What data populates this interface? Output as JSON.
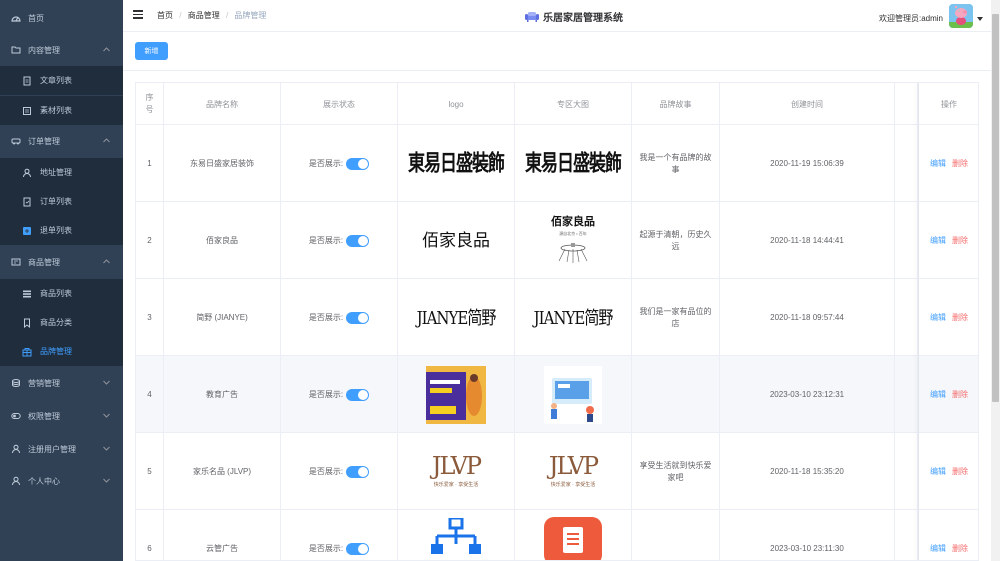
{
  "sidebar": {
    "items": [
      {
        "label": "首页",
        "icon": "dashboard-icon",
        "type": "top",
        "active": false
      },
      {
        "label": "内容管理",
        "icon": "folder-icon",
        "type": "group",
        "active": false
      },
      {
        "label": "文章列表",
        "icon": "document-icon",
        "type": "sub",
        "active": false
      },
      {
        "label": "素材列表",
        "icon": "media-icon",
        "type": "sub",
        "active": false
      },
      {
        "label": "订单管理",
        "icon": "truck-icon",
        "type": "group",
        "active": false
      },
      {
        "label": "地址管理",
        "icon": "user-icon",
        "type": "sub",
        "active": false
      },
      {
        "label": "订单列表",
        "icon": "order-icon",
        "type": "sub",
        "active": false
      },
      {
        "label": "退单列表",
        "icon": "refund-icon",
        "type": "sub",
        "active": false
      },
      {
        "label": "商品管理",
        "icon": "goods-icon",
        "type": "group",
        "active": false
      },
      {
        "label": "商品列表",
        "icon": "list-icon",
        "type": "sub",
        "active": false
      },
      {
        "label": "商品分类",
        "icon": "bookmark-icon",
        "type": "sub",
        "active": false
      },
      {
        "label": "品牌管理",
        "icon": "brand-icon",
        "type": "sub",
        "active": true
      },
      {
        "label": "营销管理",
        "icon": "coins-icon",
        "type": "group",
        "active": false
      },
      {
        "label": "权限管理",
        "icon": "toggle-icon",
        "type": "group",
        "active": false
      },
      {
        "label": "注册用户管理",
        "icon": "user-icon",
        "type": "group",
        "active": false
      },
      {
        "label": "个人中心",
        "icon": "user-icon",
        "type": "group",
        "active": false
      }
    ]
  },
  "header": {
    "breadcrumb": [
      "首页",
      "商品管理",
      "品牌管理"
    ],
    "separator": "/",
    "system_title": "乐居家居管理系统",
    "welcome": "欢迎管理员:admin"
  },
  "toolbar": {
    "add_label": "新增"
  },
  "table": {
    "columns": [
      "序号",
      "品牌名称",
      "展示状态",
      "logo",
      "专区大图",
      "品牌故事",
      "创建时间",
      "",
      "操作"
    ],
    "switch_label": "是否展示:",
    "edit_label": "编辑",
    "delete_label": "删除",
    "rows": [
      {
        "index": "1",
        "name": "东易日盛家居装饰",
        "story": "我是一个有品牌的故事",
        "created": "2020-11-19 15:06:39",
        "logo_text": "東易日盛裝飾",
        "banner_text": "東易日盛裝飾",
        "image_kind": "dongyi",
        "shown": true
      },
      {
        "index": "2",
        "name": "佰家良品",
        "story": "起源于清朝，历史久远",
        "created": "2020-11-18 14:44:41",
        "logo_text": "佰家良品",
        "banner_text": "佰家良品",
        "banner_sub": "源自北京 • 百年",
        "image_kind": "baijia",
        "shown": true
      },
      {
        "index": "3",
        "name": "简野 (JIANYE)",
        "story": "我们是一家有品位的店",
        "created": "2020-11-18 09:57:44",
        "logo_text": "JIANYE简野",
        "banner_text": "JIANYE简野",
        "image_kind": "jianye",
        "shown": true
      },
      {
        "index": "4",
        "name": "教育广告",
        "story": "",
        "created": "2023-03-10 23:12:31",
        "logo_text": "暑期快乐",
        "banner_text": "",
        "image_kind": "edu",
        "shown": true
      },
      {
        "index": "5",
        "name": "家乐名品 (JLVP)",
        "story": "享受生活就到快乐爱家吧",
        "created": "2020-11-18 15:35:20",
        "logo_text": "JLVP",
        "logo_sub": "快乐爱家 · 享受生活",
        "banner_text": "JLVP",
        "banner_sub": "快乐爱家 · 享受生活",
        "image_kind": "jlvp",
        "shown": true
      },
      {
        "index": "6",
        "name": "云管广告",
        "story": "",
        "created": "2023-03-10 23:11:30",
        "logo_text": "",
        "banner_text": "",
        "image_kind": "cloud",
        "shown": true
      }
    ]
  },
  "colors": {
    "sidebar_bg": "#304156",
    "sidebar_sub_bg": "#1f2d3d",
    "sidebar_text": "#bfcbd9",
    "primary": "#409eff",
    "danger": "#f56c6c",
    "row_highlight": "#f5f7fa"
  }
}
